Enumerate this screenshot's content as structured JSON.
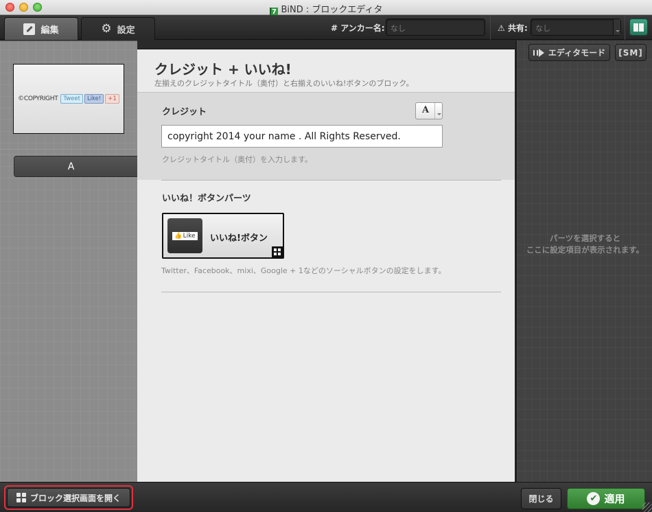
{
  "window": {
    "title": "BiND : ブロックエディタ",
    "app_icon_label": "7"
  },
  "toolbar": {
    "tabs": [
      {
        "label": "編集",
        "icon": "pencil-icon",
        "active": true
      },
      {
        "label": "設定",
        "icon": "gear-icon",
        "active": false
      }
    ],
    "anchor_label": "# アンカー名:",
    "anchor_value": "なし",
    "share_label": "共有:",
    "share_value": "なし",
    "share_icon": "share-triangle-icon",
    "book_icon": "book-icon"
  },
  "left_panel": {
    "preview": {
      "copyright_text": "©COPYRIGHT",
      "tweet": "Tweet",
      "like": "Like!",
      "plus": "+1"
    },
    "variation_button": "A"
  },
  "block": {
    "title": "クレジット + いいね!",
    "description": "左揃えのクレジットタイトル（奥付）と右揃えのいいね!ボタンのブロック。",
    "credit": {
      "label": "クレジット",
      "font_button": "A",
      "value": "copyright 2014 your name . All Rights Reserved.",
      "help": "クレジットタイトル（奥付）を入力します。"
    },
    "like_parts": {
      "label": "いいね！ボタンパーツ",
      "tile_name": "いいね!ボタン",
      "badge_text": "Like",
      "help": "Twitter、Facebook、mixi、Google + 1などのソーシャルボタンの設定をします。"
    }
  },
  "right_panel": {
    "editor_mode": "エディタモード",
    "sm": "[SM]",
    "hint_line1": "パーツを選択すると",
    "hint_line2": "ここに設定項目が表示されます。"
  },
  "bottom": {
    "open_blocks": "ブロック選択画面を開く",
    "close": "閉じる",
    "apply": "適用",
    "highlight_color": "#e0313d",
    "apply_color": "#3f8f3f"
  }
}
